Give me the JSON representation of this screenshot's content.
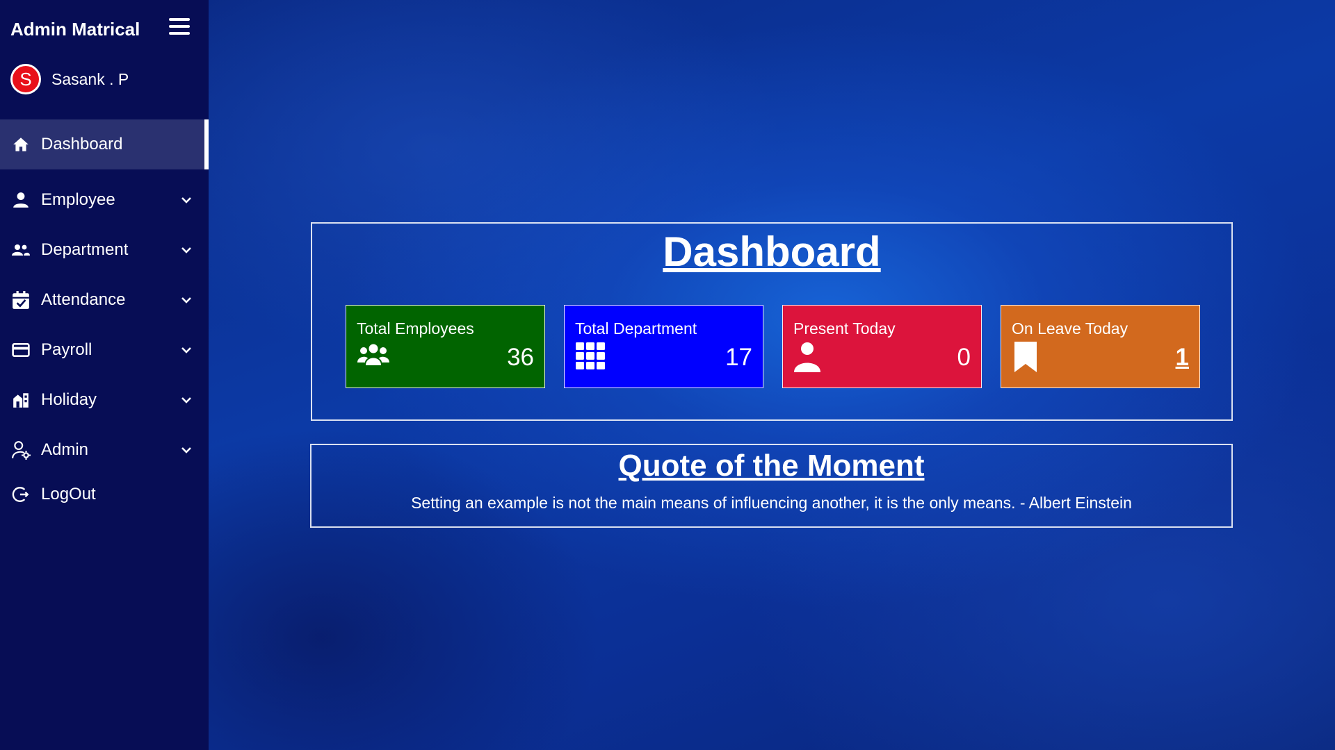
{
  "sidebar": {
    "brand": "Admin Matrical",
    "user": {
      "initial": "S",
      "name": "Sasank . P"
    },
    "items": [
      {
        "label": "Dashboard",
        "icon": "home-icon",
        "active": true
      },
      {
        "label": "Employee",
        "icon": "person-icon",
        "expandable": true
      },
      {
        "label": "Department",
        "icon": "people-icon",
        "expandable": true
      },
      {
        "label": "Attendance",
        "icon": "calendar-check-icon",
        "expandable": true
      },
      {
        "label": "Payroll",
        "icon": "credit-card-icon",
        "expandable": true
      },
      {
        "label": "Holiday",
        "icon": "building-icon",
        "expandable": true
      },
      {
        "label": "Admin",
        "icon": "admin-user-icon",
        "expandable": true
      },
      {
        "label": "LogOut",
        "icon": "logout-icon"
      }
    ]
  },
  "dashboard": {
    "title": "Dashboard",
    "cards": [
      {
        "label": "Total Employees",
        "value": "36",
        "icon": "users-group-icon",
        "color": "#016400"
      },
      {
        "label": "Total Department",
        "value": "17",
        "icon": "grid-icon",
        "color": "#0000ff"
      },
      {
        "label": "Present Today",
        "value": "0",
        "icon": "user-icon",
        "color": "#dc143c"
      },
      {
        "label": "On Leave Today",
        "value": "1",
        "icon": "bookmark-icon",
        "color": "#d2691e"
      }
    ]
  },
  "quote": {
    "title": "Quote of the Moment",
    "text": "Setting an example is not the main means of influencing another, it is the only means. - Albert Einstein"
  }
}
